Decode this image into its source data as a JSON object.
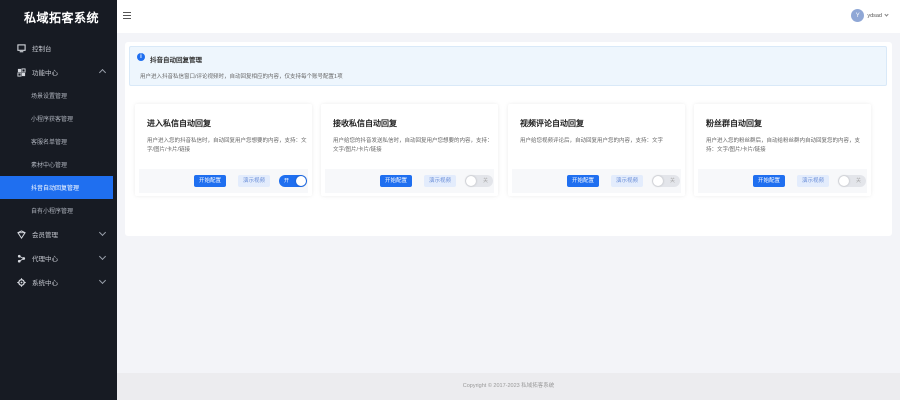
{
  "app": {
    "title": "私域拓客系统"
  },
  "sidebar": {
    "items": [
      {
        "label": "控制台",
        "icon": "dashboard-icon"
      },
      {
        "label": "功能中心",
        "icon": "function-icon",
        "expanded": true,
        "children": [
          {
            "label": "场景设置管理"
          },
          {
            "label": "小程序获客管理"
          },
          {
            "label": "客服名单管理"
          },
          {
            "label": "素材中心管理"
          },
          {
            "label": "抖音自动回复管理",
            "active": true
          },
          {
            "label": "自有小程序管理"
          }
        ]
      },
      {
        "label": "会员管理",
        "icon": "member-icon"
      },
      {
        "label": "代理中心",
        "icon": "agent-icon"
      },
      {
        "label": "系统中心",
        "icon": "system-icon"
      }
    ]
  },
  "header": {
    "username": "ydsad",
    "avatar_text": "Y"
  },
  "notice": {
    "title": "抖音自动回复管理",
    "desc": "用户进入抖音私信窗口/评论视频时，自动回复相应的内容，仅支持每个账号配置1项"
  },
  "cards": [
    {
      "title": "进入私信自动回复",
      "desc": "用户进入您的抖音私信时，自动回复用户您想要的内容，支持：文字/图片/卡片/链接",
      "config_label": "开始配置",
      "demo_label": "演示视频",
      "switch_on": true,
      "switch_text": "开"
    },
    {
      "title": "接收私信自动回复",
      "desc": "用户给您的抖音发送私信时，自动回复用户您想要的内容，支持：文字/图片/卡片/链接",
      "config_label": "开始配置",
      "demo_label": "演示视频",
      "switch_on": false,
      "switch_text": "关"
    },
    {
      "title": "视频评论自动回复",
      "desc": "用户给您视频评论后，自动回复用户您的内容，支持：文字",
      "config_label": "开始配置",
      "demo_label": "演示视频",
      "switch_on": false,
      "switch_text": "关"
    },
    {
      "title": "粉丝群自动回复",
      "desc": "用户进入您的粉丝群后，自动给粉丝群内自动回复您的内容，支持：文字/图片/卡片/链接",
      "config_label": "开始配置",
      "demo_label": "演示视频",
      "switch_on": false,
      "switch_text": "关"
    }
  ],
  "footer": {
    "text": "Copyright © 2017-2023 私域拓客系统"
  },
  "colors": {
    "accent": "#1f6ff0",
    "sidebar_bg": "#171b23"
  }
}
